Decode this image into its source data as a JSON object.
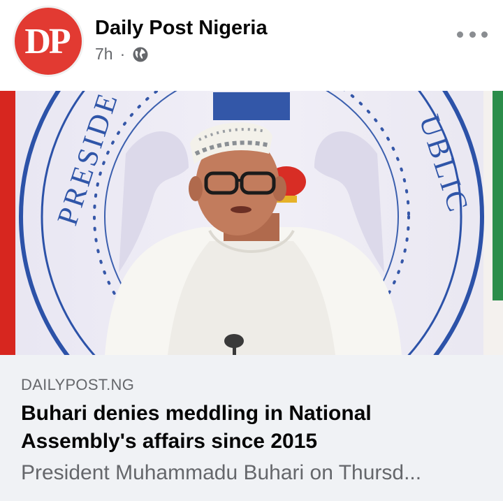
{
  "post": {
    "avatar_text": "DP",
    "page_name": "Daily Post Nigeria",
    "timestamp": "7h",
    "separator": "·",
    "audience_icon": "globe-icon",
    "more_icon": "more-horizontal-icon"
  },
  "link_preview": {
    "image_seal_left_text": "PRESIDE",
    "image_seal_right_text": "UBLIC",
    "domain": "DAILYPOST.NG",
    "headline": "Buhari denies meddling in National Assembly's affairs since 2015",
    "snippet": "President Muhammadu Buhari on Thursd..."
  },
  "colors": {
    "brand_red": "#e23a32",
    "text_primary": "#050505",
    "text_secondary": "#65676b",
    "link_box_bg": "#f0f2f5"
  }
}
